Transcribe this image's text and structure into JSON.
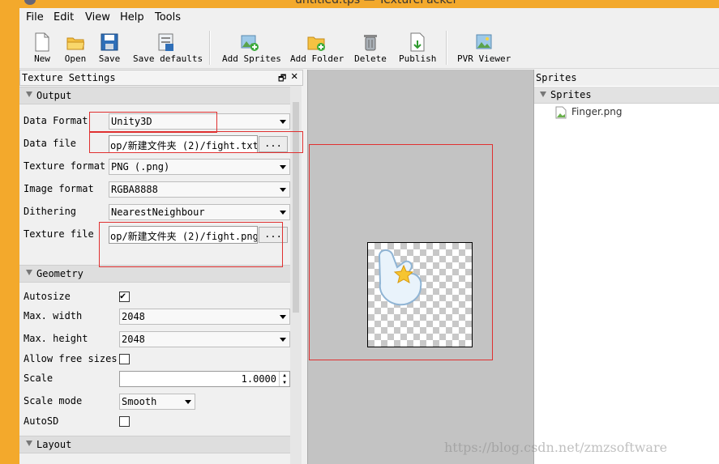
{
  "window": {
    "title": "untitled.tps — TexturePacker"
  },
  "menu": [
    "File",
    "Edit",
    "View",
    "Help",
    "Tools"
  ],
  "toolbar": {
    "new": "New",
    "open": "Open",
    "save": "Save",
    "save_defaults": "Save defaults",
    "add_sprites": "Add Sprites",
    "add_folder": "Add Folder",
    "delete": "Delete",
    "publish": "Publish",
    "pvr_viewer": "PVR Viewer"
  },
  "panel": {
    "title": "Texture Settings",
    "float_glyph": "🗗",
    "close_glyph": "✕"
  },
  "output": {
    "title": "Output",
    "data_format_label": "Data Format",
    "data_format": "Unity3D",
    "data_file_label": "Data file",
    "data_file": "op/新建文件夹 (2)/fight.txt",
    "texture_format_label": "Texture format",
    "texture_format": "PNG (.png)",
    "image_format_label": "Image format",
    "image_format": "RGBA8888",
    "dithering_label": "Dithering",
    "dithering": "NearestNeighbour",
    "texture_file_label": "Texture file",
    "texture_file": "op/新建文件夹 (2)/fight.png",
    "browse": "..."
  },
  "geometry": {
    "title": "Geometry",
    "autosize_label": "Autosize",
    "autosize": true,
    "max_width_label": "Max. width",
    "max_width": "2048",
    "max_height_label": "Max. height",
    "max_height": "2048",
    "allow_free_label": "Allow free sizes",
    "allow_free": false,
    "scale_label": "Scale",
    "scale": "1.0000",
    "scale_mode_label": "Scale mode",
    "scale_mode": "Smooth",
    "autosd_label": "AutoSD",
    "autosd": false
  },
  "layout": {
    "title": "Layout"
  },
  "sprites_panel": {
    "title": "Sprites",
    "section": "Sprites",
    "items": [
      "Finger.png"
    ]
  },
  "watermark": "https://blog.csdn.net/zmzsoftware",
  "colors": {
    "frame": "#f3a92c",
    "highlight": "#e03030",
    "canvas": "#c3c3c3"
  }
}
